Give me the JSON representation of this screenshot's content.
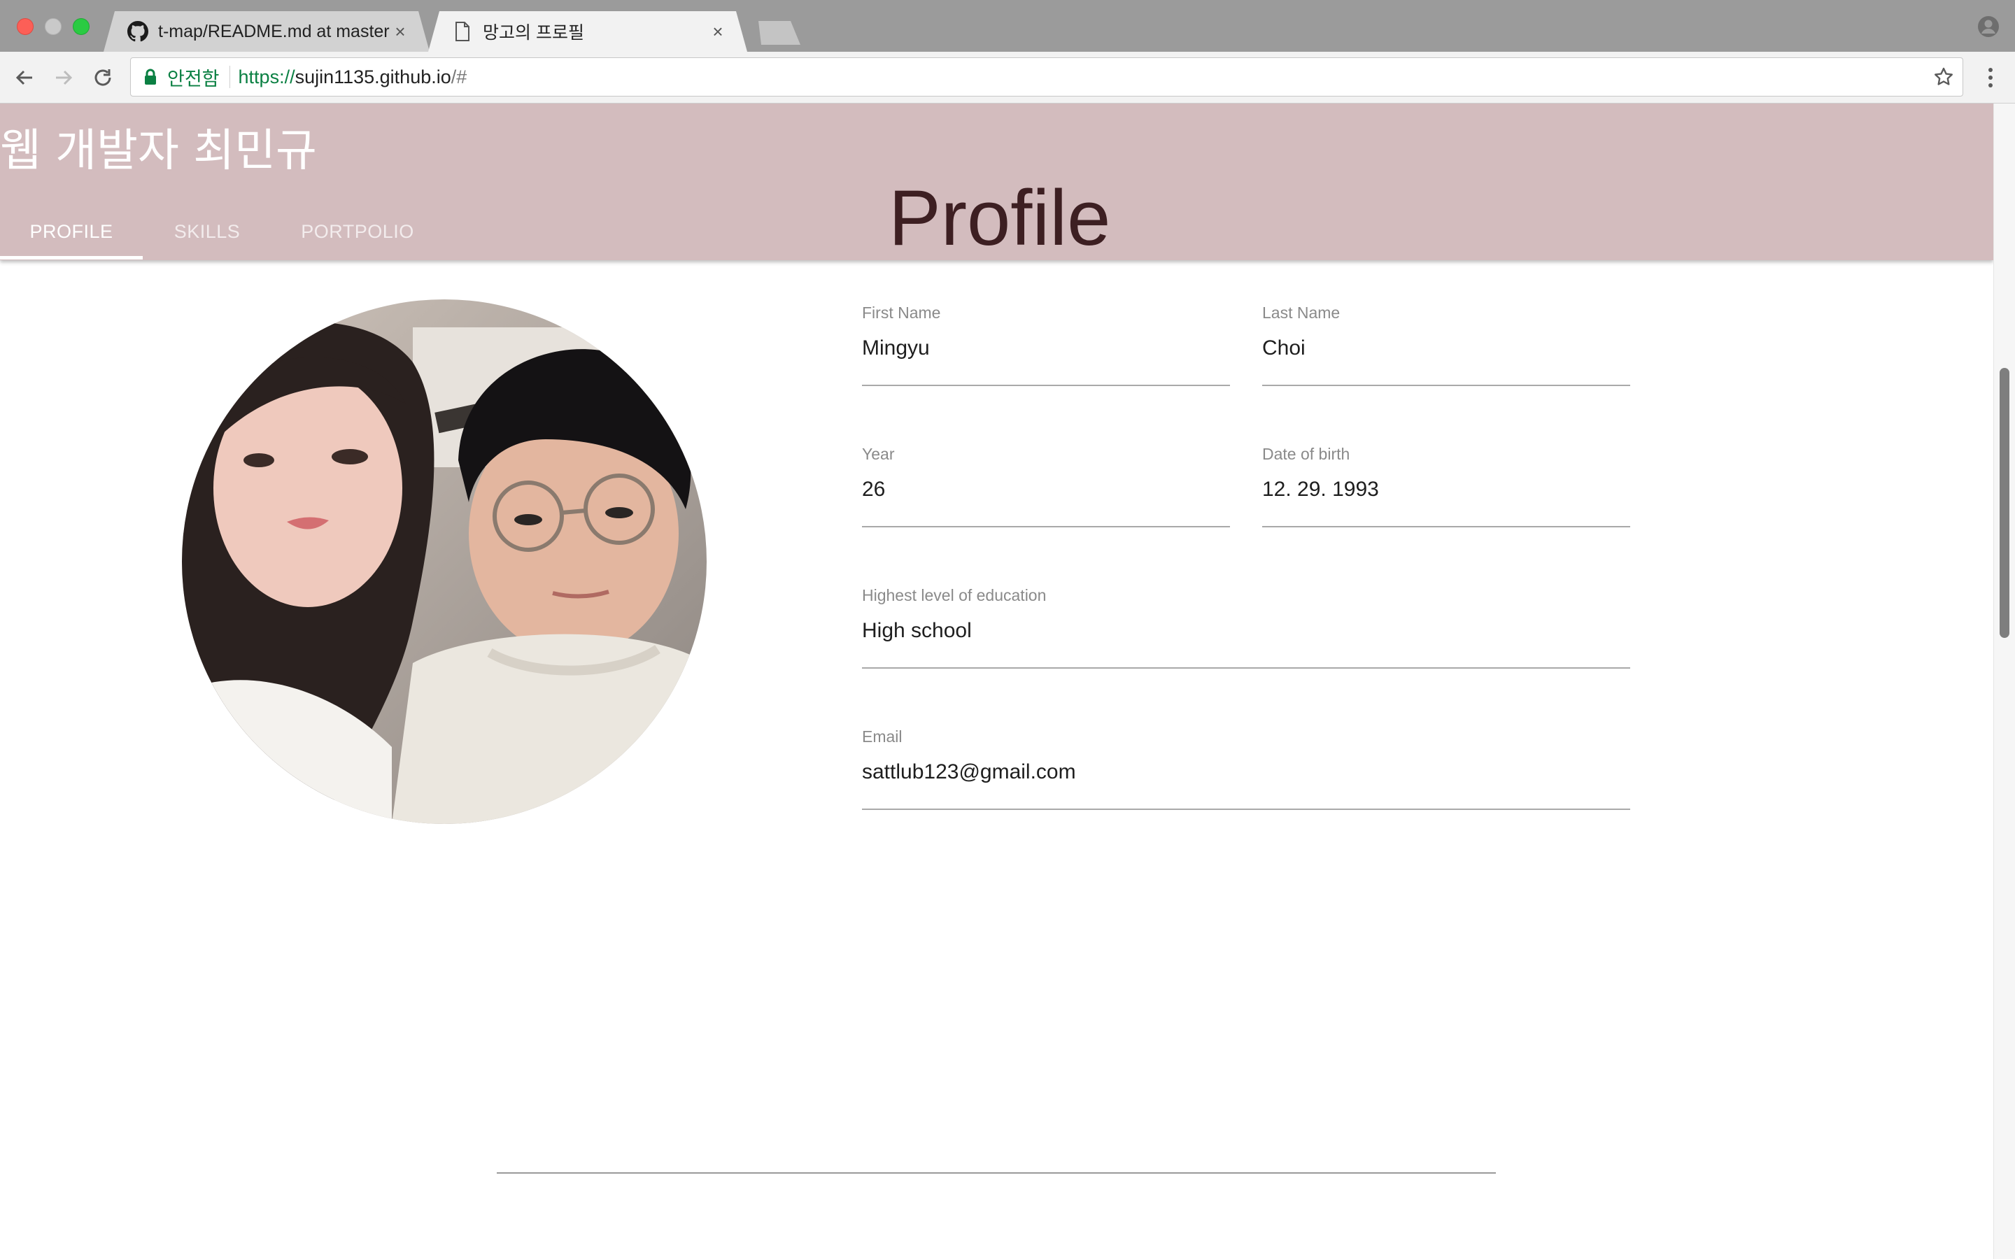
{
  "browser": {
    "tabs": [
      {
        "title": "t-map/README.md at master ·",
        "favicon": "github-icon",
        "active": false
      },
      {
        "title": "망고의 프로필",
        "favicon": "page-icon",
        "active": true
      }
    ],
    "security_label": "안전함",
    "url": {
      "scheme": "https://",
      "host": "sujin1135.github.io",
      "path": "/#"
    }
  },
  "app": {
    "title": "웹 개발자 최민규",
    "nav_tabs": [
      {
        "label": "PROFILE",
        "active": true
      },
      {
        "label": "SKILLS",
        "active": false
      },
      {
        "label": "PORTPOLIO",
        "active": false
      }
    ],
    "section_heading": "Profile"
  },
  "profile": {
    "first_name": {
      "label": "First Name",
      "value": "Mingyu"
    },
    "last_name": {
      "label": "Last Name",
      "value": "Choi"
    },
    "year": {
      "label": "Year",
      "value": "26"
    },
    "date_of_birth": {
      "label": "Date of birth",
      "value": "12. 29. 1993"
    },
    "education": {
      "label": "Highest level of education",
      "value": "High school"
    },
    "email": {
      "label": "Email",
      "value": "sattlub123@gmail.com"
    }
  },
  "colors": {
    "appbar": "#d3bcbe",
    "heading": "#3d1f22",
    "secure_green": "#0b8043"
  }
}
